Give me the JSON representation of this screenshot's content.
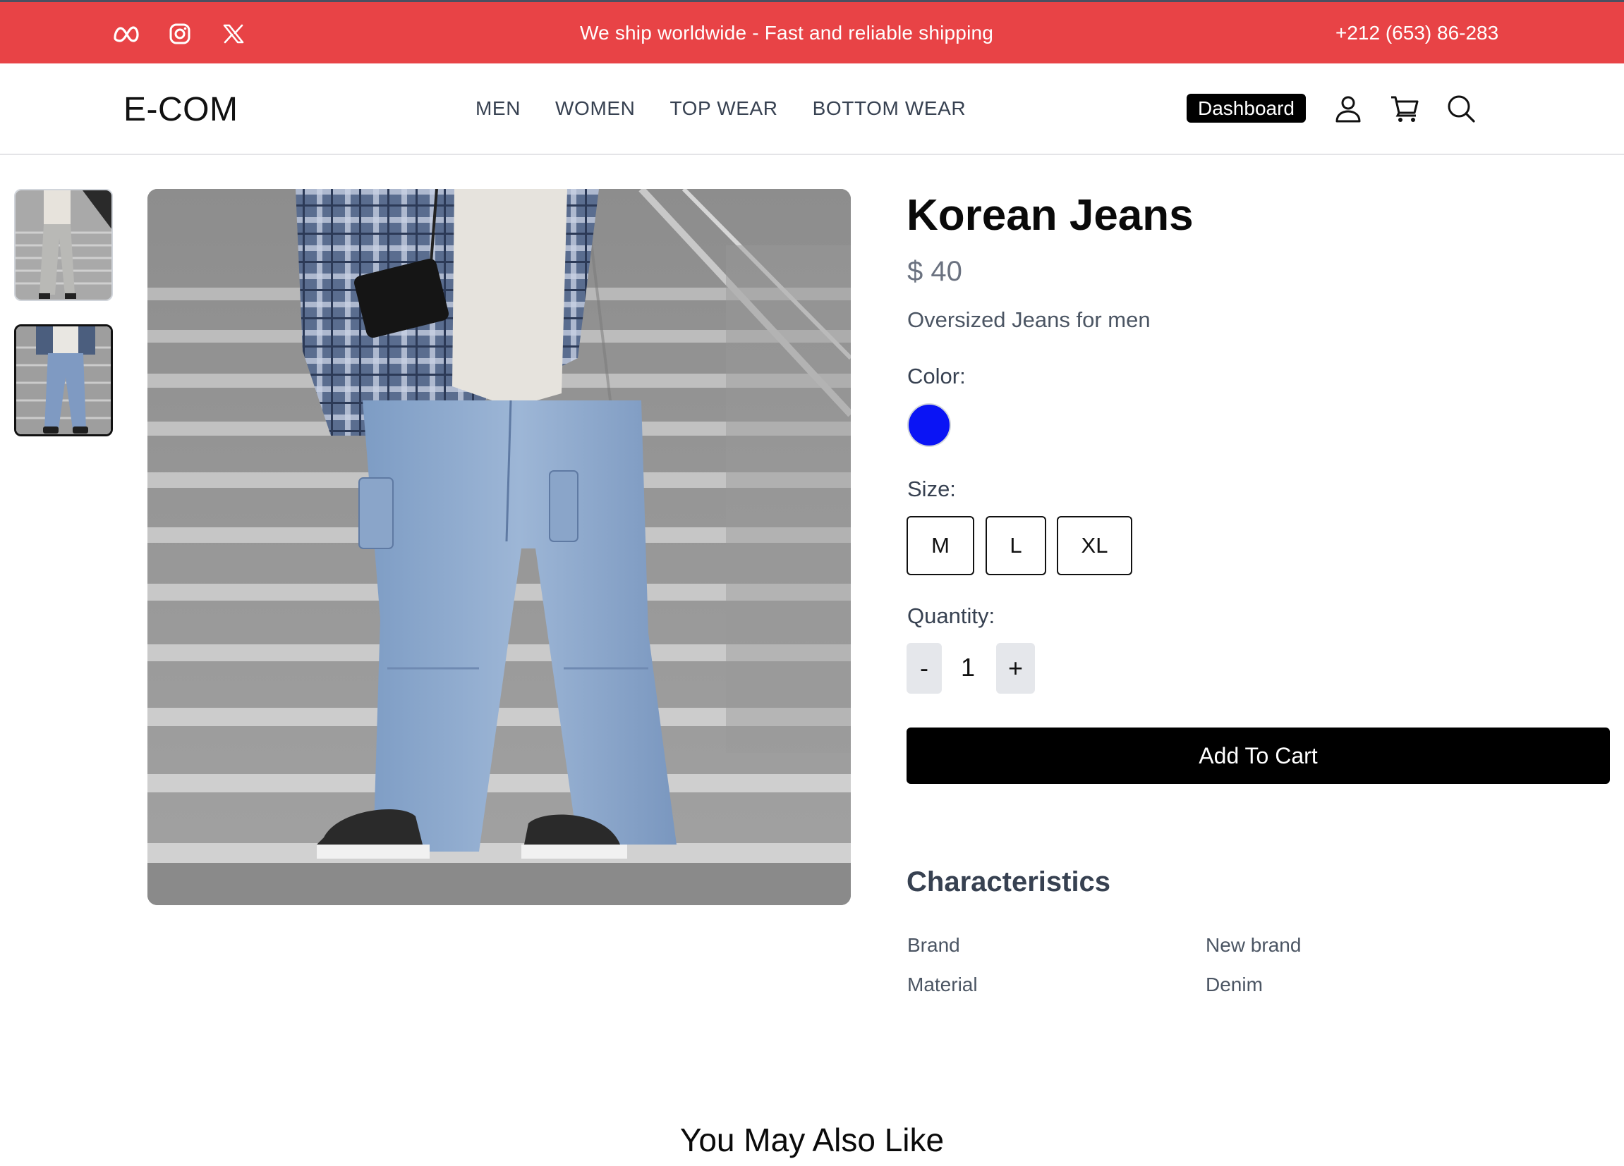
{
  "topbar": {
    "announcement": "We ship worldwide - Fast and reliable shipping",
    "phone": "+212 (653) 86-283",
    "socials": [
      "meta-icon",
      "instagram-icon",
      "x-icon"
    ],
    "background": "#e84346"
  },
  "header": {
    "logo": "E-COM",
    "nav": [
      "MEN",
      "WOMEN",
      "TOP WEAR",
      "BOTTOM WEAR"
    ],
    "dashboard_label": "Dashboard",
    "icons": [
      "user-icon",
      "cart-icon",
      "search-icon"
    ]
  },
  "product": {
    "name": "Korean Jeans",
    "price": "$ 40",
    "description": "Oversized Jeans for men",
    "color_label": "Color:",
    "colors": [
      "#0a14f5"
    ],
    "size_label": "Size:",
    "sizes": [
      "M",
      "L",
      "XL"
    ],
    "quantity_label": "Quantity:",
    "quantity": "1",
    "minus": "-",
    "plus": "+",
    "add_to_cart": "Add To Cart"
  },
  "characteristics": {
    "title": "Characteristics",
    "rows": [
      {
        "key": "Brand",
        "value": "New brand"
      },
      {
        "key": "Material",
        "value": "Denim"
      }
    ]
  },
  "related": {
    "title": "You May Also Like"
  }
}
